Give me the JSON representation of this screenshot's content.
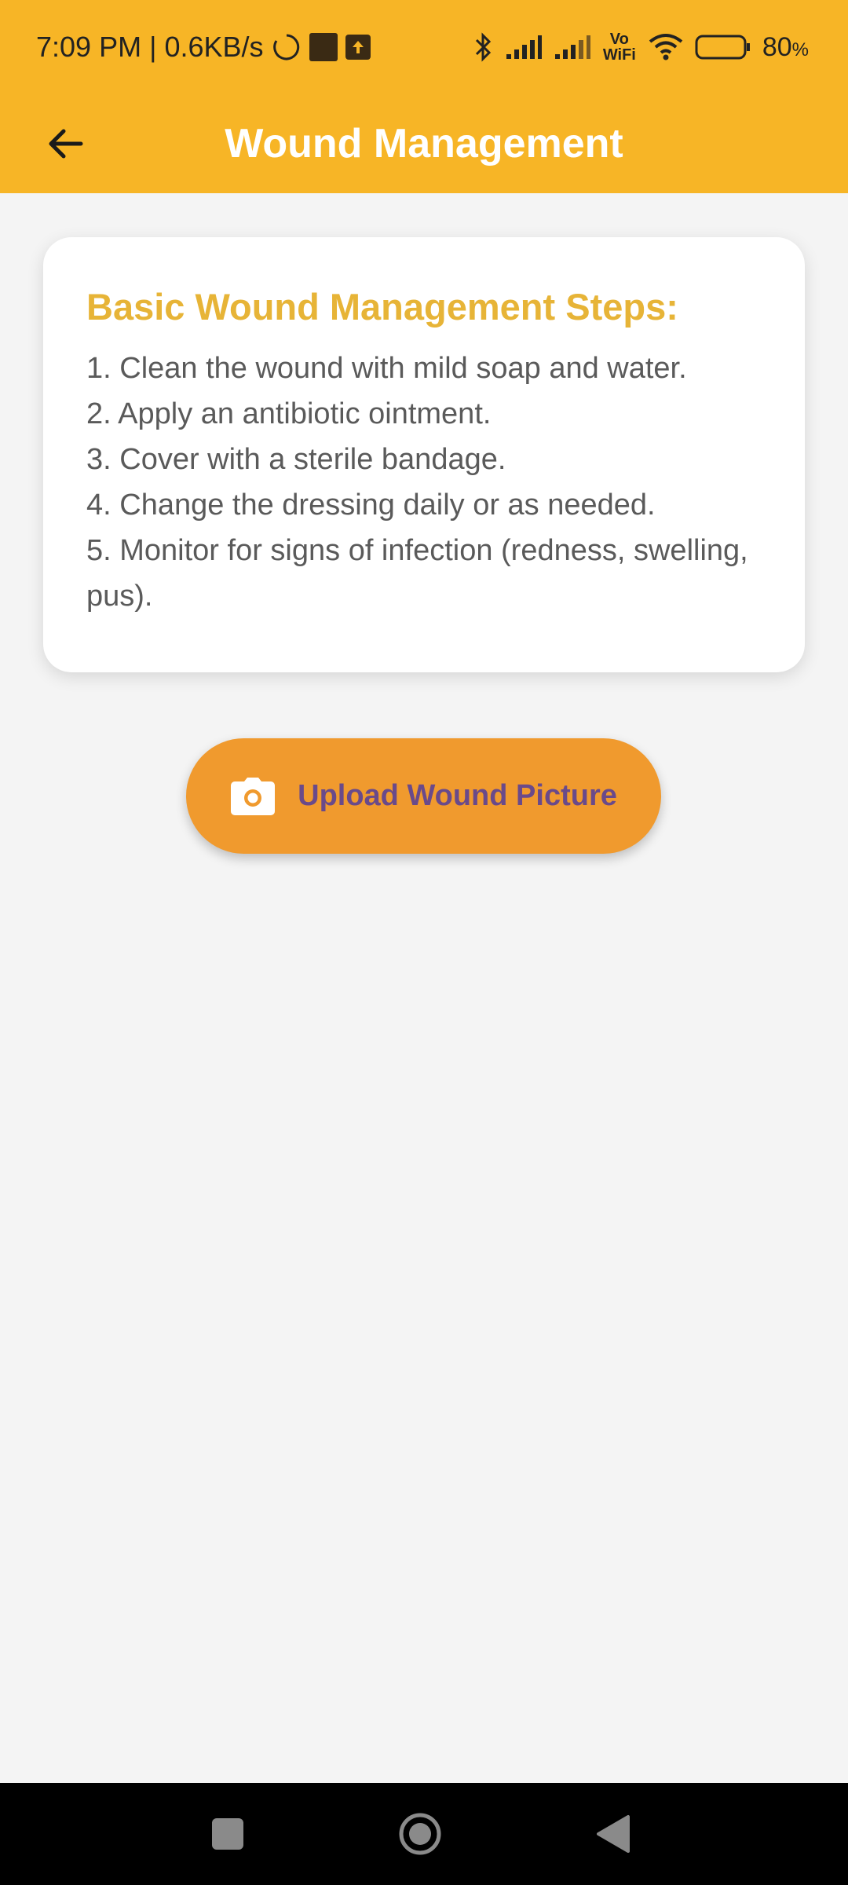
{
  "status_bar": {
    "time": "7:09 PM",
    "separator": "|",
    "net_speed": "0.6KB/s",
    "vowifi": "Vo WiFi",
    "battery": "80",
    "battery_unit": "%",
    "icons": [
      "sync-circle-icon",
      "notification-square-icon",
      "upload-icon",
      "bluetooth-icon",
      "signal-icon",
      "signal-icon",
      "wifi-icon",
      "battery-icon"
    ]
  },
  "app_bar": {
    "title": "Wound Management",
    "back_icon": "arrow-left-icon"
  },
  "card": {
    "heading": "Basic Wound Management Steps:",
    "steps": [
      "1. Clean the wound with mild soap and water.",
      "2. Apply an antibiotic ointment.",
      "3. Cover with a sterile bandage.",
      "4. Change the dressing daily or as needed.",
      "5. Monitor for signs of infection (redness, swelling, pus)."
    ]
  },
  "upload_button": {
    "label": "Upload Wound Picture",
    "icon": "camera-icon"
  },
  "colors": {
    "app_bar": "#f7b526",
    "heading": "#e7b437",
    "button": "#f09a2e",
    "button_text": "#6a4a8a",
    "background": "#f4f4f4"
  }
}
